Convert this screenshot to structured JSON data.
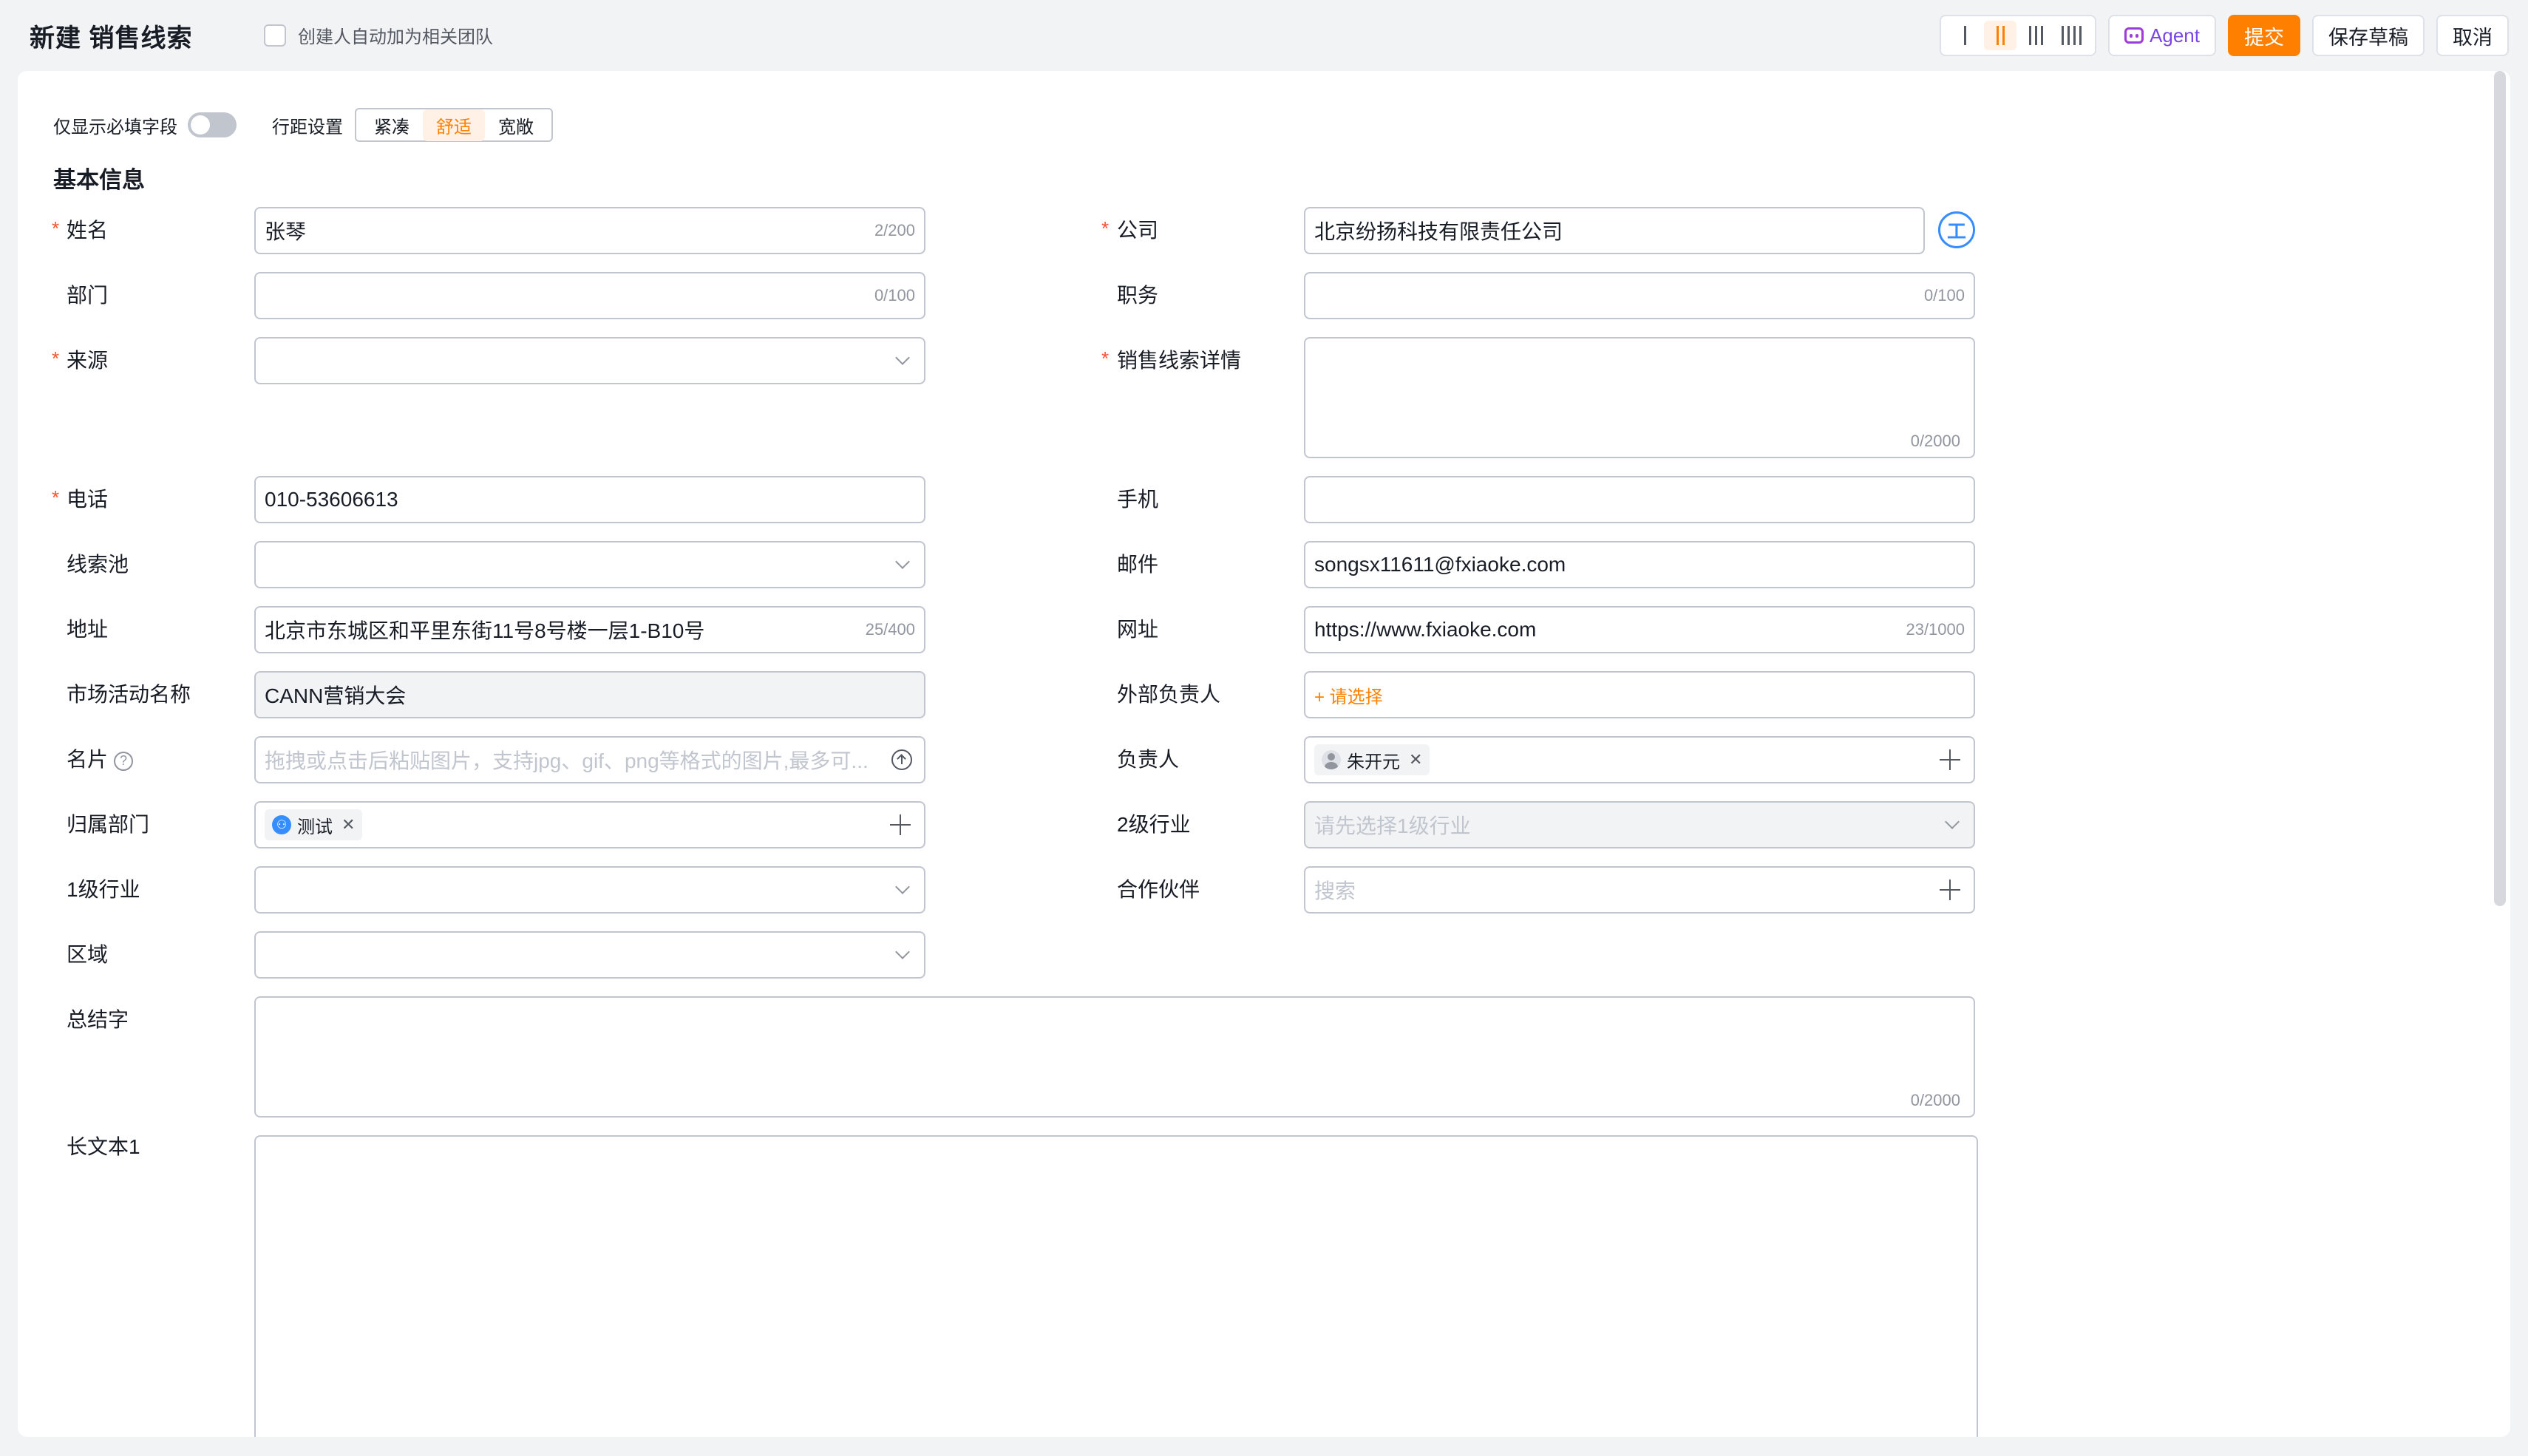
{
  "header": {
    "title": "新建 销售线索",
    "auto_team_label": "创建人自动加为相关团队",
    "agent_label": "Agent",
    "submit_label": "提交",
    "save_draft_label": "保存草稿",
    "cancel_label": "取消"
  },
  "options": {
    "required_only_label": "仅显示必填字段",
    "spacing_label": "行距设置",
    "spacing_options": [
      "紧凑",
      "舒适",
      "宽敞"
    ],
    "spacing_selected": "舒适"
  },
  "section": {
    "title": "基本信息"
  },
  "fields": {
    "name": {
      "label": "姓名",
      "value": "张琴",
      "counter": "2/200"
    },
    "company": {
      "label": "公司",
      "value": "北京纷扬科技有限责任公司",
      "icon_text": "工"
    },
    "department": {
      "label": "部门",
      "value": "",
      "counter": "0/100"
    },
    "position": {
      "label": "职务",
      "value": "",
      "counter": "0/100"
    },
    "source": {
      "label": "来源",
      "value": ""
    },
    "lead_detail": {
      "label": "销售线索详情",
      "counter": "0/2000"
    },
    "phone": {
      "label": "电话",
      "value": "010-53606613"
    },
    "mobile": {
      "label": "手机",
      "value": ""
    },
    "lead_pool": {
      "label": "线索池",
      "value": ""
    },
    "email": {
      "label": "邮件",
      "value": "songsx11611@fxiaoke.com"
    },
    "address": {
      "label": "地址",
      "value": "北京市东城区和平里东街11号8号楼一层1-B10号",
      "counter": "25/400"
    },
    "website": {
      "label": "网址",
      "value": "https://www.fxiaoke.com",
      "counter": "23/1000"
    },
    "campaign": {
      "label": "市场活动名称",
      "value": "CANN营销大会"
    },
    "external_owner": {
      "label": "外部负责人",
      "link": "+ 请选择"
    },
    "business_card": {
      "label": "名片",
      "placeholder": "拖拽或点击后粘贴图片，支持jpg、gif、png等格式的图片,最多可..."
    },
    "owner": {
      "label": "负责人",
      "tag": "朱开元"
    },
    "owner_department": {
      "label": "归属部门",
      "tag": "测试"
    },
    "industry_level2": {
      "label": "2级行业",
      "placeholder": "请先选择1级行业"
    },
    "industry_level1": {
      "label": "1级行业",
      "value": ""
    },
    "partner": {
      "label": "合作伙伴",
      "placeholder": "搜索"
    },
    "region": {
      "label": "区域",
      "value": ""
    },
    "summary": {
      "label": "总结字",
      "counter": "0/2000"
    },
    "long_text1": {
      "label": "长文本1"
    }
  }
}
